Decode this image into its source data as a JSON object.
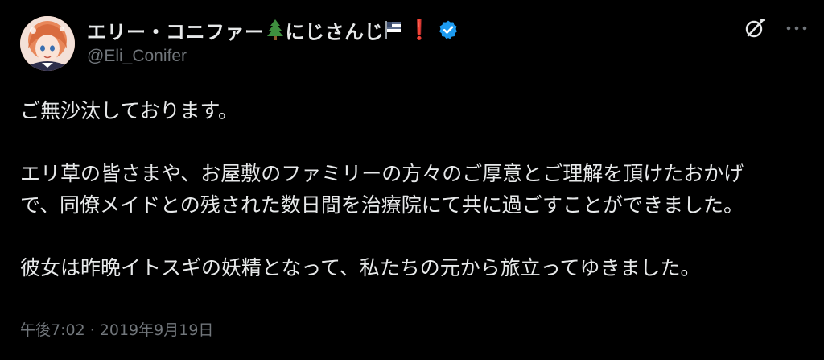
{
  "author": {
    "display_name": "エリー・コニファー",
    "display_name_suffix": "にじさんじ",
    "exclamation": "❗",
    "handle": "@Eli_Conifer",
    "verified_color": "#1d9bf0"
  },
  "icons": {
    "tree": "evergreen-tree-emoji",
    "flag": "flag-emoji",
    "verified": "verified-badge-icon",
    "grok": "grok-icon",
    "more": "more-icon"
  },
  "tweet": {
    "line1": "ご無沙汰しております。",
    "line2": "エリ草の皆さまや、お屋敷のファミリーの方々のご厚意とご理解を頂けたおかげ",
    "line3": "で、同僚メイドとの残された数日間を治療院にて共に過ごすことができました。",
    "line4": "彼女は昨晩イトスギの妖精となって、私たちの元から旅立ってゆきました。"
  },
  "meta": {
    "time": "午後7:02",
    "separator": " · ",
    "date": "2019年9月19日"
  },
  "colors": {
    "background": "#000000",
    "text": "#e7e9ea",
    "secondary": "#71767b",
    "accent": "#1d9bf0"
  }
}
